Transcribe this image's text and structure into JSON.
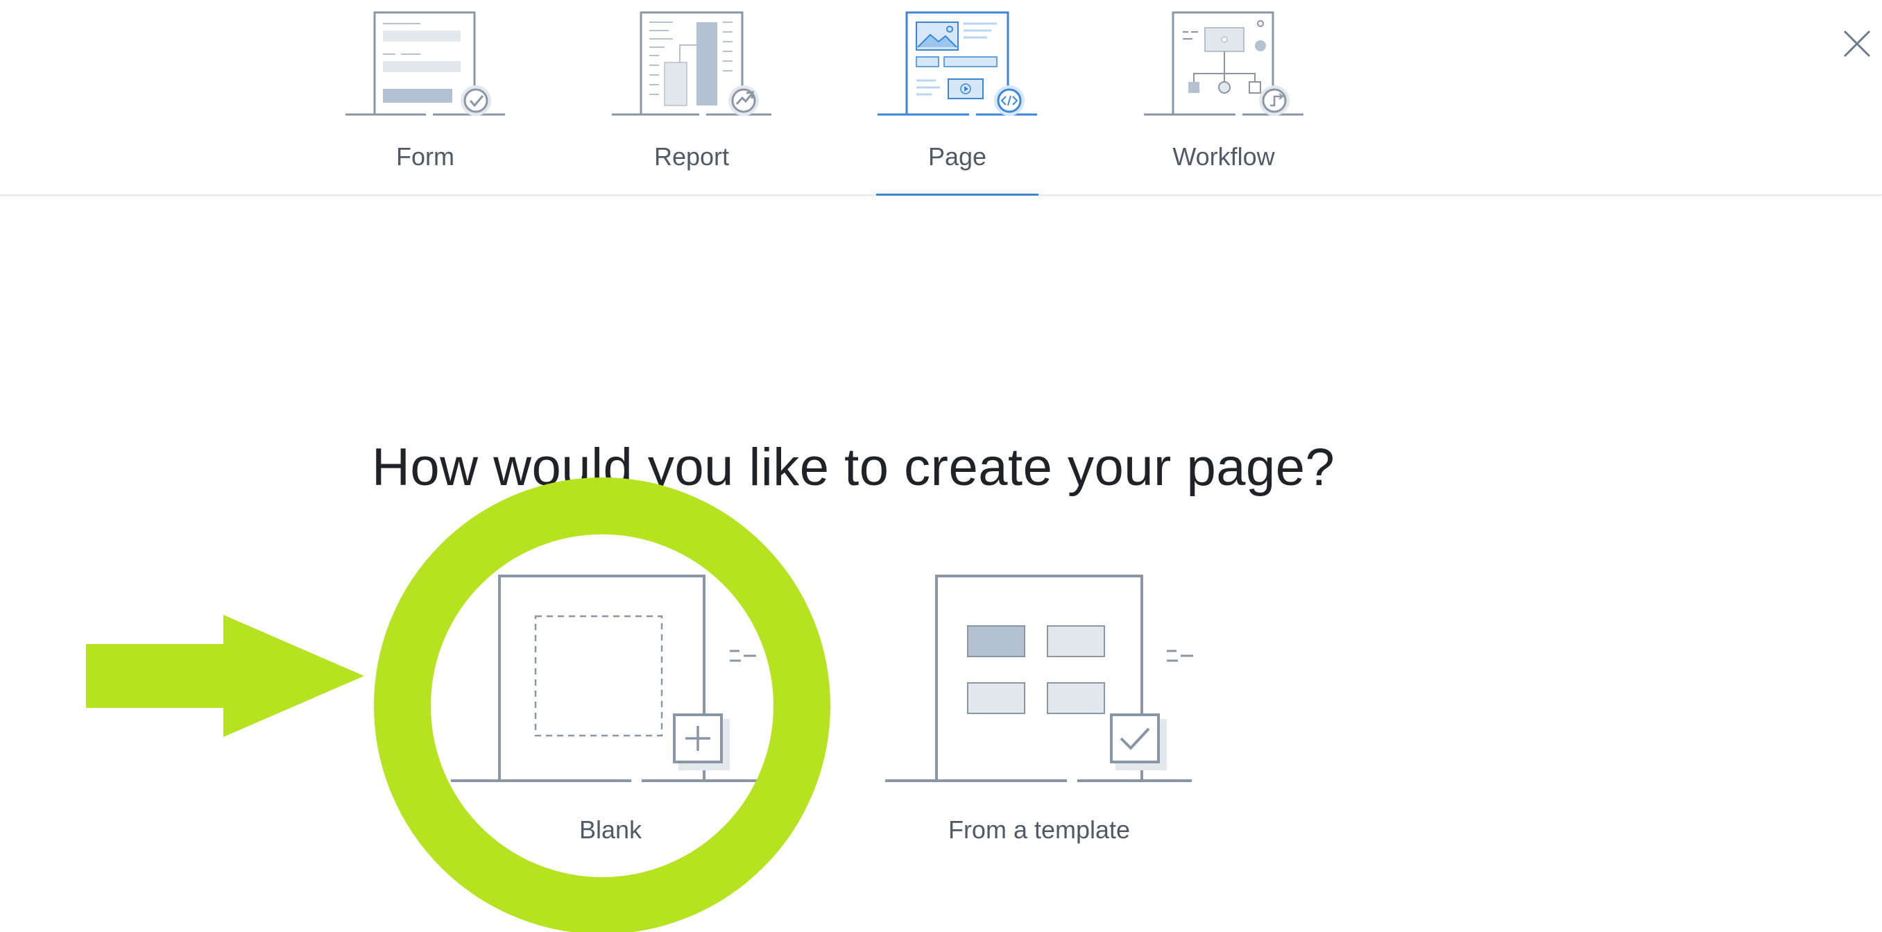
{
  "tabs": [
    {
      "id": "form",
      "label": "Form",
      "active": false,
      "icon": "form-icon"
    },
    {
      "id": "report",
      "label": "Report",
      "active": false,
      "icon": "report-icon"
    },
    {
      "id": "page",
      "label": "Page",
      "active": true,
      "icon": "page-icon"
    },
    {
      "id": "workflow",
      "label": "Workflow",
      "active": false,
      "icon": "workflow-icon"
    }
  ],
  "close": {
    "icon": "close-icon"
  },
  "question": "How would you like to create your page?",
  "options": [
    {
      "id": "blank",
      "label": "Blank",
      "icon": "blank-plus-icon"
    },
    {
      "id": "template",
      "label": "From a template",
      "icon": "template-check-icon"
    }
  ],
  "colors": {
    "accent": "#3a86d8",
    "line": "#8a96a5",
    "fill_light": "#e3e8ed",
    "fill_dark": "#b4c1d1",
    "text": "#505a66",
    "highlight": "#b5e31f"
  }
}
